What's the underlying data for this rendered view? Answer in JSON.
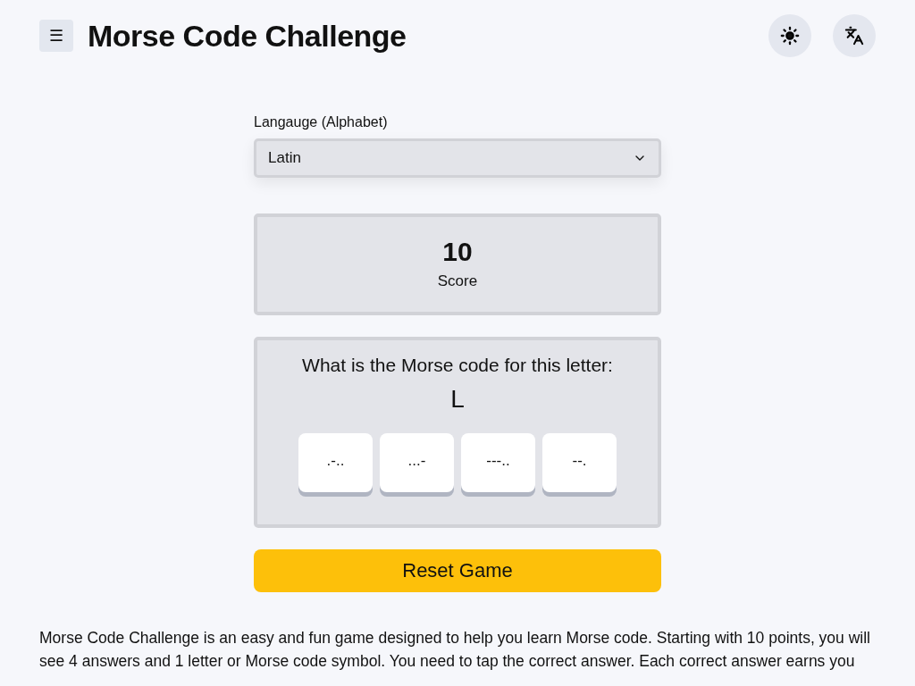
{
  "header": {
    "menu_icon": "☰",
    "title": "Morse Code Challenge"
  },
  "language": {
    "label": "Langauge (Alphabet)",
    "value": "Latin"
  },
  "score": {
    "value": "10",
    "label": "Score"
  },
  "question": {
    "prompt": "What is the Morse code for this letter:",
    "letter": "L",
    "answers": [
      {
        "code": ".-.."
      },
      {
        "code": "...-"
      },
      {
        "code": "---.."
      },
      {
        "code": "--."
      }
    ]
  },
  "reset_button": "Reset Game",
  "description": "Morse Code Challenge is an easy and fun game designed to help you learn Morse code. Starting with 10 points, you will see 4 answers and 1 letter or Morse code symbol. You need to tap the correct answer. Each correct answer earns you"
}
